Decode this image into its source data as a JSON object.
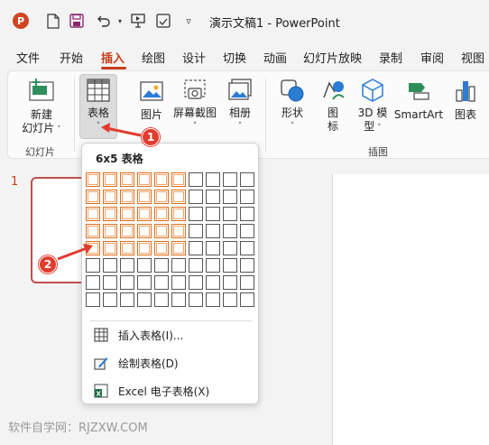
{
  "title_bar": {
    "app_logo": "P",
    "document_title": "演示文稿1  -  PowerPoint"
  },
  "menu": {
    "tabs": [
      "文件",
      "开始",
      "插入",
      "绘图",
      "设计",
      "切换",
      "动画",
      "幻灯片放映",
      "录制",
      "审阅",
      "视图"
    ],
    "active_tab": "插入"
  },
  "ribbon": {
    "new_slide_label_1": "新建",
    "new_slide_label_2": "幻灯片",
    "slides_group_label": "幻灯片",
    "table_label": "表格",
    "picture_label": "图片",
    "screenshot_label": "屏幕截图",
    "album_label": "相册",
    "shape_label": "形状",
    "icon_label_1": "图",
    "icon_label_2": "标",
    "model3d_label_1": "3D 模",
    "model3d_label_2": "型",
    "smartart_label": "SmartArt",
    "chart_label": "图表",
    "illustrations_group_label": "插图"
  },
  "table_dropdown": {
    "grid_title": "6x5 表格",
    "columns": 10,
    "rows": 8,
    "selected_columns": 6,
    "selected_rows": 5,
    "insert_table": "插入表格(I)...",
    "draw_table": "绘制表格(D)",
    "excel_table": "Excel 电子表格(X)"
  },
  "slides": {
    "slide_number": "1"
  },
  "annotations": {
    "badge_1": "1",
    "badge_2": "2"
  },
  "watermark": "软件自学网：RJZXW.COM",
  "colors": {
    "accent": "#c43e1c",
    "grid_selected": "#e06c1a",
    "badge": "#e23b2e"
  }
}
